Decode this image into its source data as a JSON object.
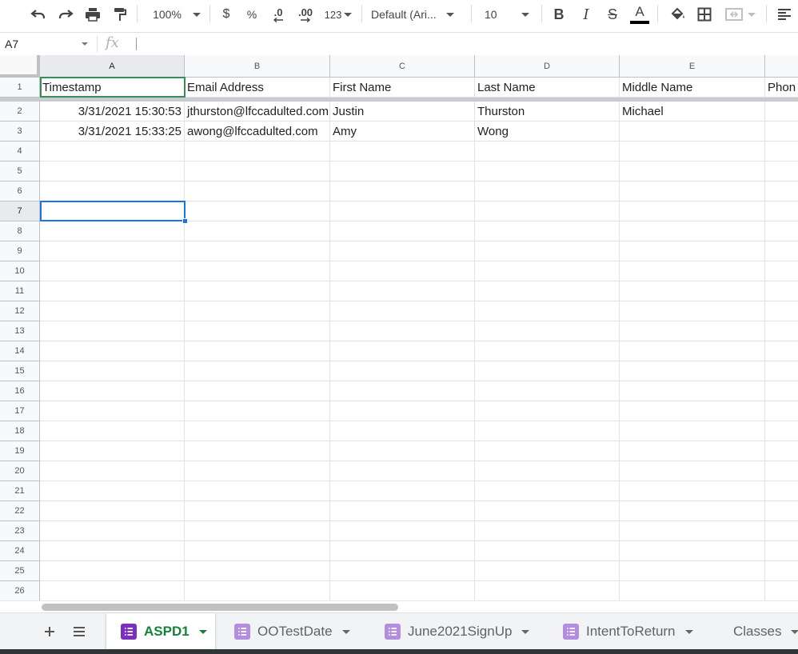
{
  "toolbar": {
    "zoom": "100%",
    "currency_symbol": "$",
    "percent_symbol": "%",
    "decrease_decimal_label": ".0",
    "increase_decimal_label": ".00",
    "number_format_label": "123",
    "font_family": "Default (Ari...",
    "font_size": "10",
    "bold_label": "B",
    "italic_label": "I",
    "strike_label": "S",
    "text_color_label": "A"
  },
  "formula_bar": {
    "name_box": "A7",
    "fx_label": "fx",
    "value": ""
  },
  "columns": [
    "A",
    "B",
    "C",
    "D",
    "E"
  ],
  "rows": [
    "1",
    "2",
    "3",
    "4",
    "5",
    "6",
    "7",
    "8",
    "9",
    "10",
    "11",
    "12",
    "13",
    "14",
    "15",
    "16",
    "17",
    "18",
    "19",
    "20",
    "21",
    "22",
    "23",
    "24",
    "25",
    "26"
  ],
  "headers": [
    "Timestamp",
    "Email Address",
    "First Name",
    "Last Name",
    "Middle Name",
    "Phon"
  ],
  "data_rows": [
    [
      "3/31/2021 15:30:53",
      "jthurston@lfccadulted.com",
      "Justin",
      "Thurston",
      "Michael"
    ],
    [
      "3/31/2021 15:33:25",
      "awong@lfccadulted.com",
      "Amy",
      "Wong",
      ""
    ]
  ],
  "active_cell": "A7",
  "sheet_tabs": [
    {
      "label": "ASPD1",
      "active": true
    },
    {
      "label": "OOTestDate",
      "active": false
    },
    {
      "label": "June2021SignUp",
      "active": false
    },
    {
      "label": "IntentToReturn",
      "active": false
    },
    {
      "label": "Classes",
      "active": false
    }
  ],
  "colors": {
    "selection": "#1a73e8",
    "active_tab_text": "#188038",
    "form_icon_active": "#7b2fbe",
    "form_icon_inactive": "#b48ede"
  }
}
